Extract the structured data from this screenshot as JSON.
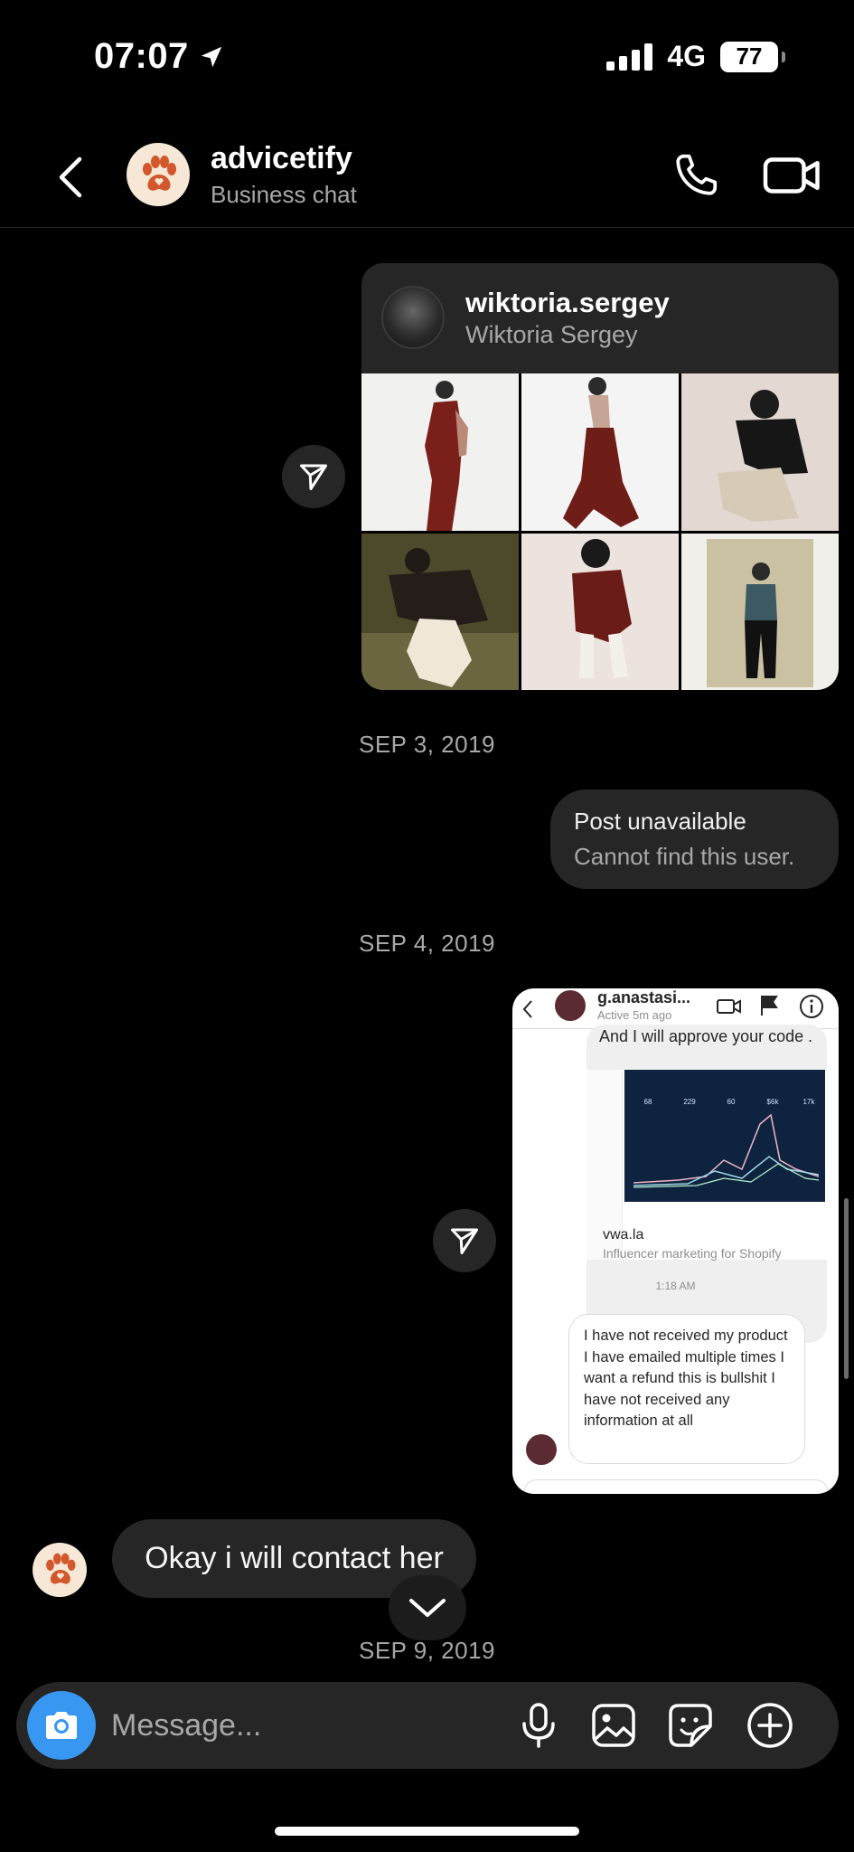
{
  "status": {
    "time": "07:07",
    "network": "4G",
    "battery": "77"
  },
  "header": {
    "name": "advicetify",
    "subtitle": "Business chat"
  },
  "shared_profile": {
    "username": "wiktoria.sergey",
    "full_name": "Wiktoria Sergey"
  },
  "dates": {
    "d1": "SEP 3, 2019",
    "d2": "SEP 4, 2019",
    "d3": "SEP 9, 2019"
  },
  "post_unavailable": {
    "title": "Post unavailable",
    "subtitle": "Cannot find this user."
  },
  "screenshot": {
    "username": "g.anastasi...",
    "active": "Active 5m ago",
    "message_top": "And I will  approve your code .",
    "link_title": "vwa.la",
    "link_subtitle": "Influencer marketing for Shopify",
    "stats": [
      "68",
      "229",
      "60",
      "$6k",
      "17k"
    ],
    "time": "1:18 AM",
    "message": "I have not received my product I have emailed multiple times I want a refund this is bullshit I have not received any information at all"
  },
  "incoming_message": "Okay i will contact her",
  "composer": {
    "placeholder": "Message..."
  },
  "colors": {
    "accent": "#3897f0",
    "bubble": "#262626",
    "background": "#000000"
  },
  "icons": [
    "location-arrow-icon",
    "back-icon",
    "paw-icon",
    "phone-icon",
    "video-camera-icon",
    "send-icon",
    "chevron-down-icon",
    "camera-icon",
    "microphone-icon",
    "gallery-icon",
    "sticker-icon",
    "plus-icon"
  ]
}
